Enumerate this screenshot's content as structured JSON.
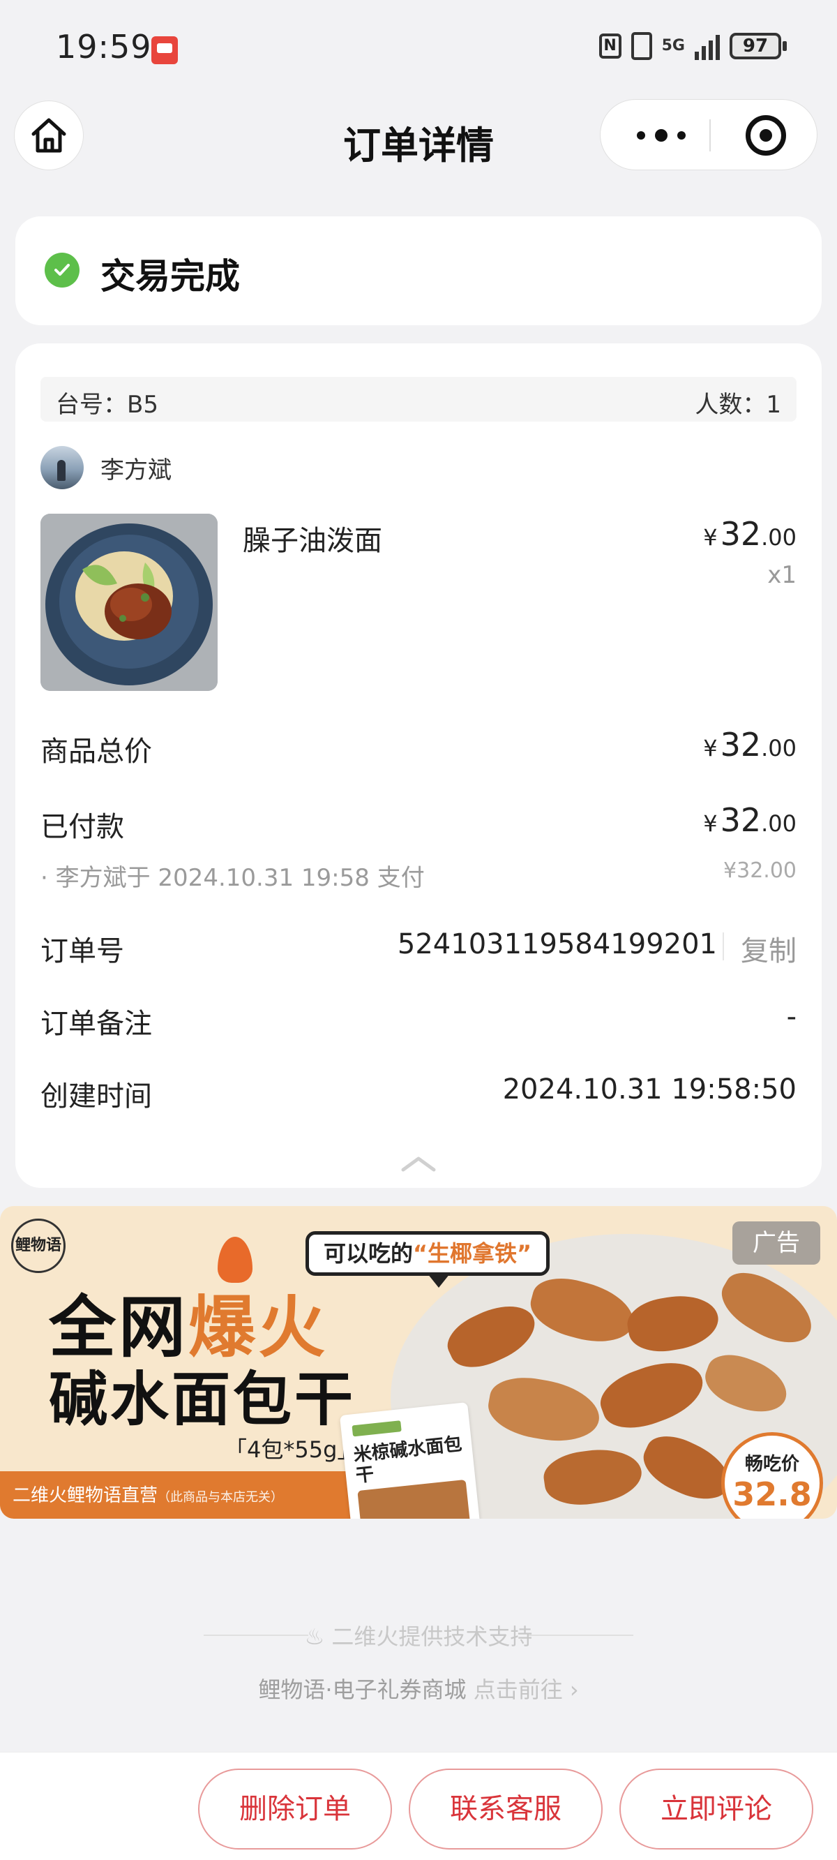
{
  "status_bar": {
    "time": "19:59",
    "nfc": "N",
    "network": "5G",
    "battery": "97"
  },
  "nav": {
    "title": "订单详情"
  },
  "order_status": {
    "text": "交易完成"
  },
  "table_info": {
    "table": "台号：B5",
    "people": "人数：1"
  },
  "customer": {
    "name": "李方斌"
  },
  "item": {
    "name": "臊子油泼面",
    "currency": "¥",
    "price_int": "32",
    "price_dec": ".00",
    "qty": "x1"
  },
  "summary": {
    "total_label": "商品总价",
    "total_int": "32",
    "total_dec": ".00",
    "paid_label": "已付款",
    "paid_int": "32",
    "paid_dec": ".00",
    "paid_note": "· 李方斌于 2024.10.31 19:58 支付",
    "paid_note_price": "¥32.00",
    "order_no_label": "订单号",
    "order_no": "524103119584199201",
    "copy": "复制",
    "remark_label": "订单备注",
    "remark": "-",
    "created_label": "创建时间",
    "created": "2024.10.31 19:58:50"
  },
  "ad": {
    "logo": "鲤物语",
    "tag": "广告",
    "bubble_prefix": "可以吃的",
    "bubble_highlight": "“生椰拿铁”",
    "headline_a": "全网",
    "headline_b": "爆火",
    "headline2": "碱水面包干",
    "spec": "「4包*55g」",
    "bottom_text": "二维火鲤物语直营",
    "bottom_note": "（此商品与本店无关）",
    "pack_text": "米椋碱水面包干",
    "price_label": "畅吃价",
    "price": "32.8"
  },
  "footer": {
    "support": "二维火提供技术支持",
    "link": "鲤物语·电子礼券商城",
    "go": "点击前往"
  },
  "actions": {
    "delete": "删除订单",
    "service": "联系客服",
    "review": "立即评论"
  }
}
